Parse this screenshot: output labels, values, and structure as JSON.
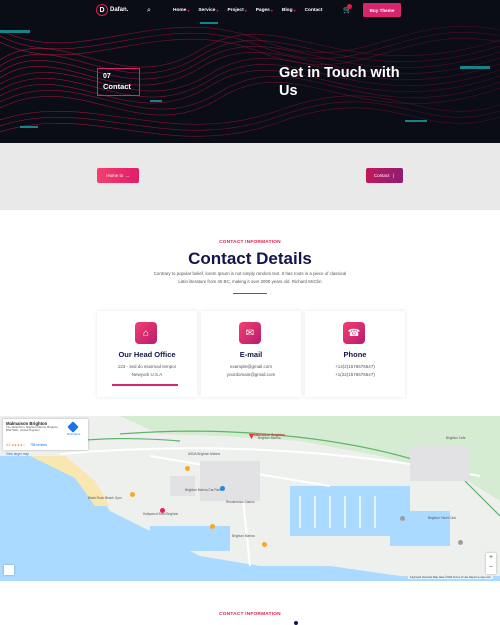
{
  "header": {
    "logo_text": "Dafan.",
    "nav": [
      {
        "label": "Home",
        "caret": true
      },
      {
        "label": "Service",
        "caret": true
      },
      {
        "label": "Project",
        "caret": true
      },
      {
        "label": "Pages",
        "caret": true
      },
      {
        "label": "Blog",
        "caret": true
      },
      {
        "label": "Contact",
        "caret": false
      }
    ],
    "buy_label": "Buy Theme",
    "icons": [
      "search-icon",
      "cart-icon"
    ]
  },
  "hero": {
    "number": "07",
    "label": "Contact",
    "title": "Get in Touch with Us"
  },
  "breadcrumb": {
    "home_label": "Home to",
    "current_label": "Contact"
  },
  "contact_section": {
    "eyebrow": "CONTACT INFORMATION",
    "title": "Contact Details",
    "text": "Contrary to popular belief, lorem Ipsum is not simply random text. It has roots in a piece of classical Latin literature from 45 BC, making it over 2000 years old. Richard McClin",
    "cards": [
      {
        "title": "Our Head Office",
        "icon": "home-icon",
        "line1": "123 - sed do eiusmod tempor",
        "line2": "Newyork U.S.A"
      },
      {
        "title": "E-mail",
        "icon": "mail-icon",
        "line1": "example@gmail.com",
        "line2": "yourdomain@gmail.com"
      },
      {
        "title": "Phone",
        "icon": "phone-icon",
        "line1": "+14(2)1576675647)",
        "line2": "+1(22)1576675647)"
      }
    ]
  },
  "map": {
    "place_name": "Malmaison Brighton",
    "address": "The Waterfront, Brighton Marina, Brighton BN2 5WA, United Kingdom",
    "rating": "4.2 ★★★★☆",
    "reviews": "798 reviews",
    "larger_map": "View larger map",
    "directions": "Directions",
    "footer": "Keyboard shortcuts   Map data ©2024   Terms of Use   Report a map error",
    "labels": [
      "Black Rock Beach Gym",
      "Brighton Marina",
      "ASDA Brighton Marina",
      "Malmaison Brighton",
      "Brighton Marina Car Park",
      "Hollywood Bowl Brighton",
      "Brighton Cafe",
      "Brighton Marina",
      "Rendezvous Casino",
      "Brighton Yacht Club"
    ],
    "zoom_in": "+",
    "zoom_out": "−"
  },
  "bottom": {
    "eyebrow": "CONTACT INFORMATION"
  },
  "colors": {
    "accent": "#d6246e",
    "navy": "#15154a",
    "hero_bg": "#0a0c16"
  }
}
